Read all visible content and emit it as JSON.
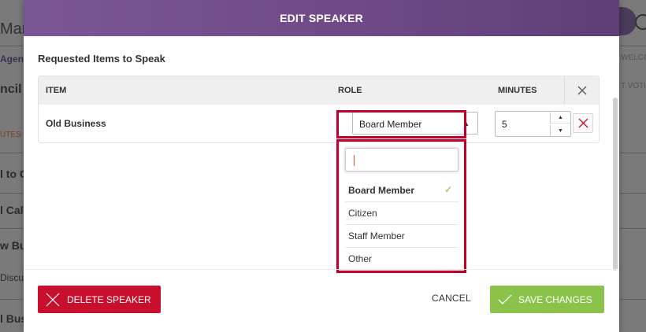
{
  "background": {
    "title_fragment": "Mar",
    "tab_fragment": "Agen",
    "heading_fragment": "ncil",
    "minutes_fragment": "UTES S",
    "welcome_fragment": "WELCO",
    "vote_fragment": "T VOTIN",
    "list_fragments": [
      "l to C",
      "l Cal",
      "w Bu",
      "Discu",
      "l Bus"
    ]
  },
  "modal": {
    "title": "EDIT SPEAKER",
    "section_title": "Requested Items to Speak",
    "table": {
      "headers": {
        "item": "ITEM",
        "role": "ROLE",
        "minutes": "MINUTES"
      },
      "row": {
        "item": "Old Business",
        "role": "Board Member",
        "minutes": "5"
      }
    },
    "dropdown": {
      "search_placeholder": "",
      "options": [
        "Board Member",
        "Citizen",
        "Staff Member",
        "Other"
      ],
      "selected": "Board Member"
    },
    "buttons": {
      "delete": "DELETE SPEAKER",
      "cancel": "CANCEL",
      "save": "SAVE CHANGES"
    }
  },
  "colors": {
    "header": "#6f4a87",
    "delete": "#c8102e",
    "save": "#8bc34a",
    "highlight": "#c0002a"
  },
  "icons": {
    "close": "close-icon",
    "delete_row": "close-icon",
    "check": "checkmark-icon"
  }
}
